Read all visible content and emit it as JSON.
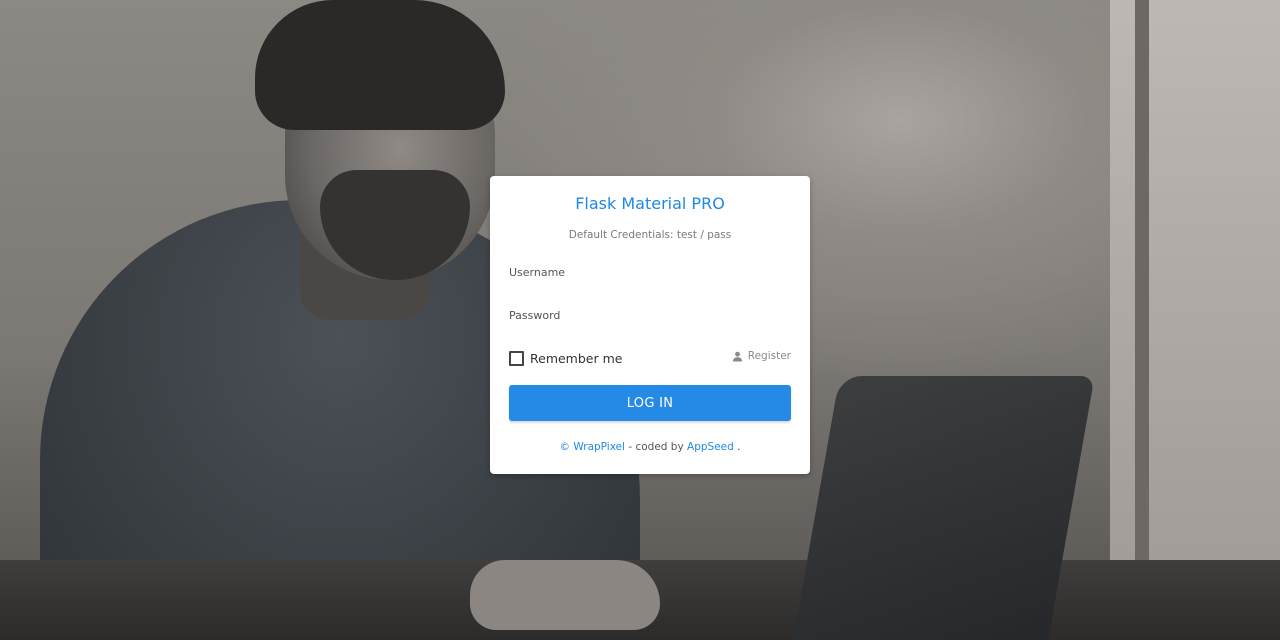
{
  "card": {
    "title": "Flask Material PRO",
    "subtitle": "Default Credentials: test / pass",
    "username_placeholder": "Username",
    "username_value": "",
    "password_placeholder": "Password",
    "password_value": "",
    "remember_label": "Remember me",
    "remember_checked": false,
    "register_label": "Register",
    "register_icon": "user-icon",
    "login_button": "LOG IN"
  },
  "footer": {
    "copyright_symbol": "©",
    "brand": "WrapPixel",
    "separator": " - ",
    "coded_by": "coded by ",
    "author": "AppSeed",
    "trailing": "."
  },
  "colors": {
    "accent": "#1e88e5",
    "button": "#2589e6"
  }
}
